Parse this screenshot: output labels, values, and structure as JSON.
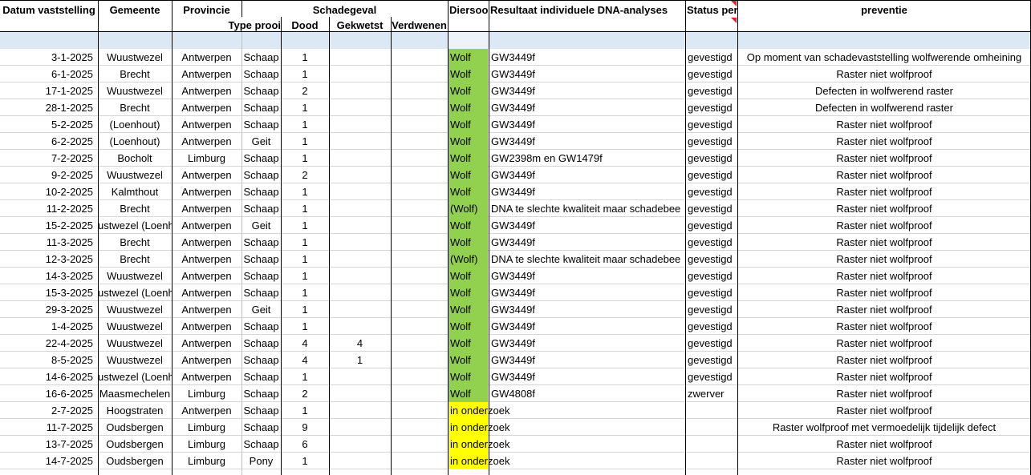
{
  "header": {
    "datum": "Datum vaststelling",
    "gemeente": "Gemeente",
    "provincie": "Provincie",
    "schadegeval": "Schadegeval",
    "diersoort": "Diersoo",
    "dna": "Resultaat individuele DNA-analyses",
    "status": "Status per",
    "preventie": "preventie",
    "type_prooi": "Type prooi",
    "dood": "Dood",
    "gekwetst": "Gekwetst",
    "verdwenen": "Verdwenen"
  },
  "colors": {
    "green": "#92d050",
    "yellow": "#ffff00",
    "filter_row": "#dde8f5",
    "comment_marker": "#e0262b"
  },
  "rows": [
    {
      "datum": "3-1-2025",
      "gemeente": "Wuustwezel",
      "provincie": "Antwerpen",
      "prooi": "Schaap",
      "dood": "1",
      "gekwetst": "",
      "diersoort": "Wolf",
      "dna": "GW3449f",
      "status": "gevestigd",
      "preventie": "Op moment van schadevaststelling wolfwerende omheining",
      "fill": "green"
    },
    {
      "datum": "6-1-2025",
      "gemeente": "Brecht",
      "provincie": "Antwerpen",
      "prooi": "Schaap",
      "dood": "1",
      "gekwetst": "",
      "diersoort": "Wolf",
      "dna": "GW3449f",
      "status": "gevestigd",
      "preventie": "Raster niet wolfproof",
      "fill": "green"
    },
    {
      "datum": "17-1-2025",
      "gemeente": "Wuustwezel",
      "provincie": "Antwerpen",
      "prooi": "Schaap",
      "dood": "2",
      "gekwetst": "",
      "diersoort": "Wolf",
      "dna": "GW3449f",
      "status": "gevestigd",
      "preventie": "Defecten in wolfwerend raster",
      "fill": "green"
    },
    {
      "datum": "28-1-2025",
      "gemeente": "Brecht",
      "provincie": "Antwerpen",
      "prooi": "Schaap",
      "dood": "1",
      "gekwetst": "",
      "diersoort": "Wolf",
      "dna": "GW3449f",
      "status": "gevestigd",
      "preventie": "Defecten in wolfwerend raster",
      "fill": "green"
    },
    {
      "datum": "5-2-2025",
      "gemeente": "(Loenhout)",
      "provincie": "Antwerpen",
      "prooi": "Schaap",
      "dood": "1",
      "gekwetst": "",
      "diersoort": "Wolf",
      "dna": "GW3449f",
      "status": "gevestigd",
      "preventie": "Raster niet wolfproof",
      "fill": "green"
    },
    {
      "datum": "6-2-2025",
      "gemeente": "(Loenhout)",
      "provincie": "Antwerpen",
      "prooi": "Geit",
      "dood": "1",
      "gekwetst": "",
      "diersoort": "Wolf",
      "dna": "GW3449f",
      "status": "gevestigd",
      "preventie": "Raster niet wolfproof",
      "fill": "green"
    },
    {
      "datum": "7-2-2025",
      "gemeente": "Bocholt",
      "provincie": "Limburg",
      "prooi": "Schaap",
      "dood": "1",
      "gekwetst": "",
      "diersoort": "Wolf",
      "dna": "GW2398m en GW1479f",
      "status": "gevestigd",
      "preventie": "Raster niet wolfproof",
      "fill": "green"
    },
    {
      "datum": "9-2-2025",
      "gemeente": "Wuustwezel",
      "provincie": "Antwerpen",
      "prooi": "Schaap",
      "dood": "2",
      "gekwetst": "",
      "diersoort": "Wolf",
      "dna": "GW3449f",
      "status": "gevestigd",
      "preventie": "Raster niet wolfproof",
      "fill": "green"
    },
    {
      "datum": "10-2-2025",
      "gemeente": "Kalmthout",
      "provincie": "Antwerpen",
      "prooi": "Schaap",
      "dood": "1",
      "gekwetst": "",
      "diersoort": "Wolf",
      "dna": "GW3449f",
      "status": "gevestigd",
      "preventie": "Raster niet wolfproof",
      "fill": "green"
    },
    {
      "datum": "11-2-2025",
      "gemeente": "Brecht",
      "provincie": "Antwerpen",
      "prooi": "Schaap",
      "dood": "1",
      "gekwetst": "",
      "diersoort": "(Wolf)",
      "dna": "DNA te slechte kwaliteit maar schadebee",
      "status": "gevestigd",
      "preventie": "Raster niet wolfproof",
      "fill": "green"
    },
    {
      "datum": "15-2-2025",
      "gemeente": "ustwezel (Loenh",
      "provincie": "Antwerpen",
      "prooi": "Geit",
      "dood": "1",
      "gekwetst": "",
      "diersoort": "Wolf",
      "dna": "GW3449f",
      "status": "gevestigd",
      "preventie": "Raster niet wolfproof",
      "fill": "green"
    },
    {
      "datum": "11-3-2025",
      "gemeente": "Brecht",
      "provincie": "Antwerpen",
      "prooi": "Schaap",
      "dood": "1",
      "gekwetst": "",
      "diersoort": "Wolf",
      "dna": "GW3449f",
      "status": "gevestigd",
      "preventie": "Raster niet wolfproof",
      "fill": "green"
    },
    {
      "datum": "12-3-2025",
      "gemeente": "Brecht",
      "provincie": "Antwerpen",
      "prooi": "Schaap",
      "dood": "1",
      "gekwetst": "",
      "diersoort": "(Wolf)",
      "dna": "DNA te slechte kwaliteit maar schadebee",
      "status": "gevestigd",
      "preventie": "Raster niet wolfproof",
      "fill": "green"
    },
    {
      "datum": "14-3-2025",
      "gemeente": "Wuustwezel",
      "provincie": "Antwerpen",
      "prooi": "Schaap",
      "dood": "1",
      "gekwetst": "",
      "diersoort": "Wolf",
      "dna": "GW3449f",
      "status": "gevestigd",
      "preventie": "Raster niet wolfproof",
      "fill": "green"
    },
    {
      "datum": "15-3-2025",
      "gemeente": "ustwezel (Loenh",
      "provincie": "Antwerpen",
      "prooi": "Schaap",
      "dood": "1",
      "gekwetst": "",
      "diersoort": "Wolf",
      "dna": "GW3449f",
      "status": "gevestigd",
      "preventie": "Raster niet wolfproof",
      "fill": "green"
    },
    {
      "datum": "29-3-2025",
      "gemeente": "Wuustwezel",
      "provincie": "Antwerpen",
      "prooi": "Geit",
      "dood": "1",
      "gekwetst": "",
      "diersoort": "Wolf",
      "dna": "GW3449f",
      "status": "gevestigd",
      "preventie": "Raster niet wolfproof",
      "fill": "green"
    },
    {
      "datum": "1-4-2025",
      "gemeente": "Wuustwezel",
      "provincie": "Antwerpen",
      "prooi": "Schaap",
      "dood": "1",
      "gekwetst": "",
      "diersoort": "Wolf",
      "dna": "GW3449f",
      "status": "gevestigd",
      "preventie": "Raster niet wolfproof",
      "fill": "green"
    },
    {
      "datum": "22-4-2025",
      "gemeente": "Wuustwezel",
      "provincie": "Antwerpen",
      "prooi": "Schaap",
      "dood": "4",
      "gekwetst": "4",
      "diersoort": "Wolf",
      "dna": "GW3449f",
      "status": "gevestigd",
      "preventie": "Raster niet wolfproof",
      "fill": "green"
    },
    {
      "datum": "8-5-2025",
      "gemeente": "Wuustwezel",
      "provincie": "Antwerpen",
      "prooi": "Schaap",
      "dood": "4",
      "gekwetst": "1",
      "diersoort": "Wolf",
      "dna": "GW3449f",
      "status": "gevestigd",
      "preventie": "Raster niet wolfproof",
      "fill": "green"
    },
    {
      "datum": "14-6-2025",
      "gemeente": "ustwezel (Loenh",
      "provincie": "Antwerpen",
      "prooi": "Schaap",
      "dood": "1",
      "gekwetst": "",
      "diersoort": "Wolf",
      "dna": "GW3449f",
      "status": "gevestigd",
      "preventie": "Raster niet wolfproof",
      "fill": "green"
    },
    {
      "datum": "16-6-2025",
      "gemeente": "Maasmechelen",
      "provincie": "Limburg",
      "prooi": "Schaap",
      "dood": "2",
      "gekwetst": "",
      "diersoort": "Wolf",
      "dna": "GW4808f",
      "status": "zwerver",
      "preventie": "Raster niet wolfproof",
      "fill": "green"
    },
    {
      "datum": "2-7-2025",
      "gemeente": "Hoogstraten",
      "provincie": "Antwerpen",
      "prooi": "Schaap",
      "dood": "1",
      "gekwetst": "",
      "diersoort": "in onderzoek",
      "dna": "",
      "status": "",
      "preventie": "Raster niet wolfproof",
      "fill": "yellow"
    },
    {
      "datum": "11-7-2025",
      "gemeente": "Oudsbergen",
      "provincie": "Limburg",
      "prooi": "Schaap",
      "dood": "9",
      "gekwetst": "",
      "diersoort": "in onderzoek",
      "dna": "",
      "status": "",
      "preventie": "Raster wolfproof met vermoedelijk tijdelijk defect",
      "fill": "yellow"
    },
    {
      "datum": "13-7-2025",
      "gemeente": "Oudsbergen",
      "provincie": "Limburg",
      "prooi": "Schaap",
      "dood": "6",
      "gekwetst": "",
      "diersoort": "in onderzoek",
      "dna": "",
      "status": "",
      "preventie": "Raster niet wolfproof",
      "fill": "yellow"
    },
    {
      "datum": "14-7-2025",
      "gemeente": "Oudsbergen",
      "provincie": "Limburg",
      "prooi": "Pony",
      "dood": "1",
      "gekwetst": "",
      "diersoort": "in onderzoek",
      "dna": "",
      "status": "",
      "preventie": "Raster niet wolfproof",
      "fill": "yellow"
    }
  ]
}
